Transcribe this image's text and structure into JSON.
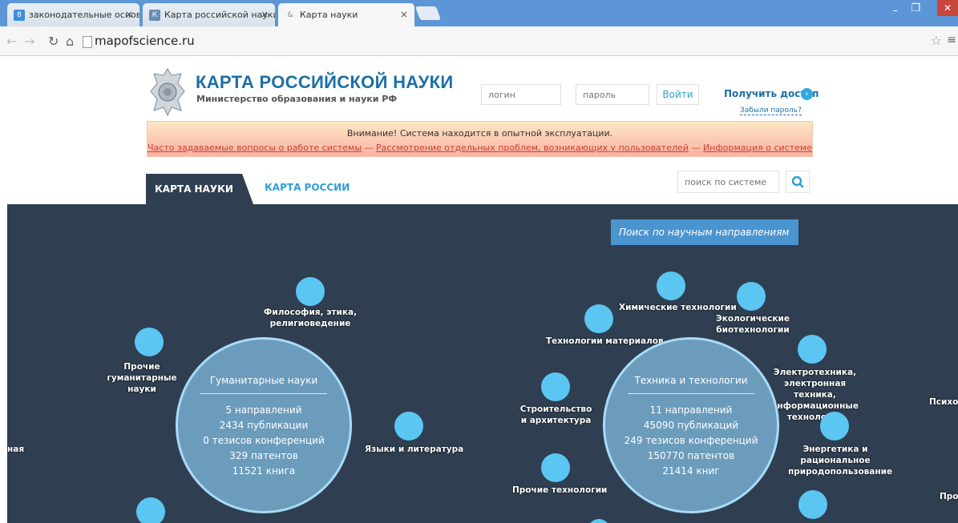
{
  "browser": {
    "tabs": [
      {
        "title": "законодательные основ",
        "icon": "8"
      },
      {
        "title": "Карта российской науки",
        "icon": "К"
      },
      {
        "title": "Карта науки",
        "icon": "&"
      }
    ],
    "url": "mapofscience.ru"
  },
  "header": {
    "title": "КАРТА РОССИЙСКОЙ НАУКИ",
    "subtitle": "Министерство образования и науки РФ",
    "login_placeholder": "логин",
    "password_placeholder": "пароль",
    "login_button": "Войти",
    "get_access": "Получить доступ",
    "forgot_password": "Забыли пароль?"
  },
  "notice": {
    "text": "Внимание! Система находится в опытной эксплуатации.",
    "links": [
      "Часто задаваемые вопросы о работе системы",
      "Рассмотрение отдельных проблем, возникающих у пользователей",
      "Информация о системе"
    ],
    "separator": "—"
  },
  "tabs": {
    "main": "КАРТА НАУКИ",
    "russia": "КАРТА РОССИИ",
    "search_placeholder": "поиск по системе"
  },
  "map": {
    "search_button": "Поиск по научным направлениям",
    "humanities": {
      "title": "Гуманитарные науки",
      "stats": [
        "5 направлений",
        "2434 публикации",
        "0 тезисов конференций",
        "329 патентов",
        "11521 книга"
      ]
    },
    "technics": {
      "title": "Техника и технологии",
      "stats": [
        "11 направлений",
        "45090 публикаций",
        "249 тезисов конференций",
        "150770 патентов",
        "21414 книг"
      ]
    },
    "labels": {
      "philosophy": "Философия, этика, религиоведение",
      "other_humanities": "Прочие гуманитарные науки",
      "languages": "Языки и литература",
      "left_edge": "ная",
      "chemical": "Химические технологии",
      "ecological": "Экологические биотехнологии",
      "materials": "Технологии материалов",
      "electrical": "Электротехника, электронная техника, информационные технологии",
      "construction": "Строительство и архитектура",
      "energy": "Энергетика и рациональное природопользование",
      "other_tech": "Прочие технологии",
      "right_edge_1": "Психо",
      "right_edge_2": "Про"
    }
  }
}
